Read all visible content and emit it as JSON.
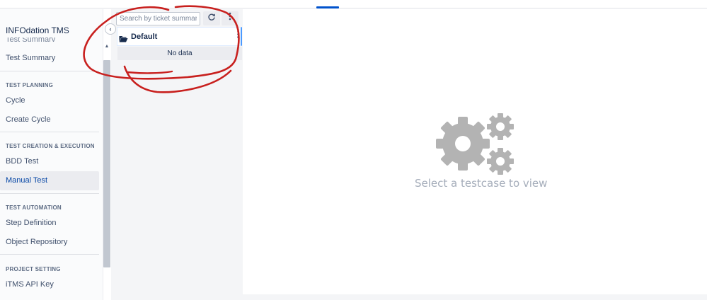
{
  "app": {
    "title": "INFOdation TMS"
  },
  "sidebar": {
    "cut_label": "Test Summary",
    "items_top": [
      {
        "label": "Test Summary"
      }
    ],
    "sections": [
      {
        "heading": "TEST PLANNING",
        "items": [
          {
            "label": "Cycle"
          },
          {
            "label": "Create Cycle"
          }
        ]
      },
      {
        "heading": "TEST CREATION & EXECUTION",
        "items": [
          {
            "label": "BDD Test"
          },
          {
            "label": "Manual Test",
            "active": true
          }
        ]
      },
      {
        "heading": "TEST AUTOMATION",
        "items": [
          {
            "label": "Step Definition"
          },
          {
            "label": "Object Repository"
          }
        ]
      },
      {
        "heading": "PROJECT SETTING",
        "items": [
          {
            "label": "iTMS API Key"
          }
        ]
      }
    ],
    "collapse_icon": "chevron-left-icon"
  },
  "tree": {
    "search": {
      "placeholder": "Search by ticket summary",
      "value": ""
    },
    "refresh_icon": "refresh-icon",
    "more_icon": "more-vertical-icon",
    "folder": {
      "label": "Default",
      "icon": "folder-open-icon"
    },
    "empty_text": "No data"
  },
  "main": {
    "empty_state_icon": "gears-icon",
    "empty_text": "Select a testcase to view"
  },
  "colors": {
    "accent": "#0052cc",
    "active_text": "#0747a6",
    "annotation": "#c8201e",
    "gear": "#b3b3b3"
  }
}
